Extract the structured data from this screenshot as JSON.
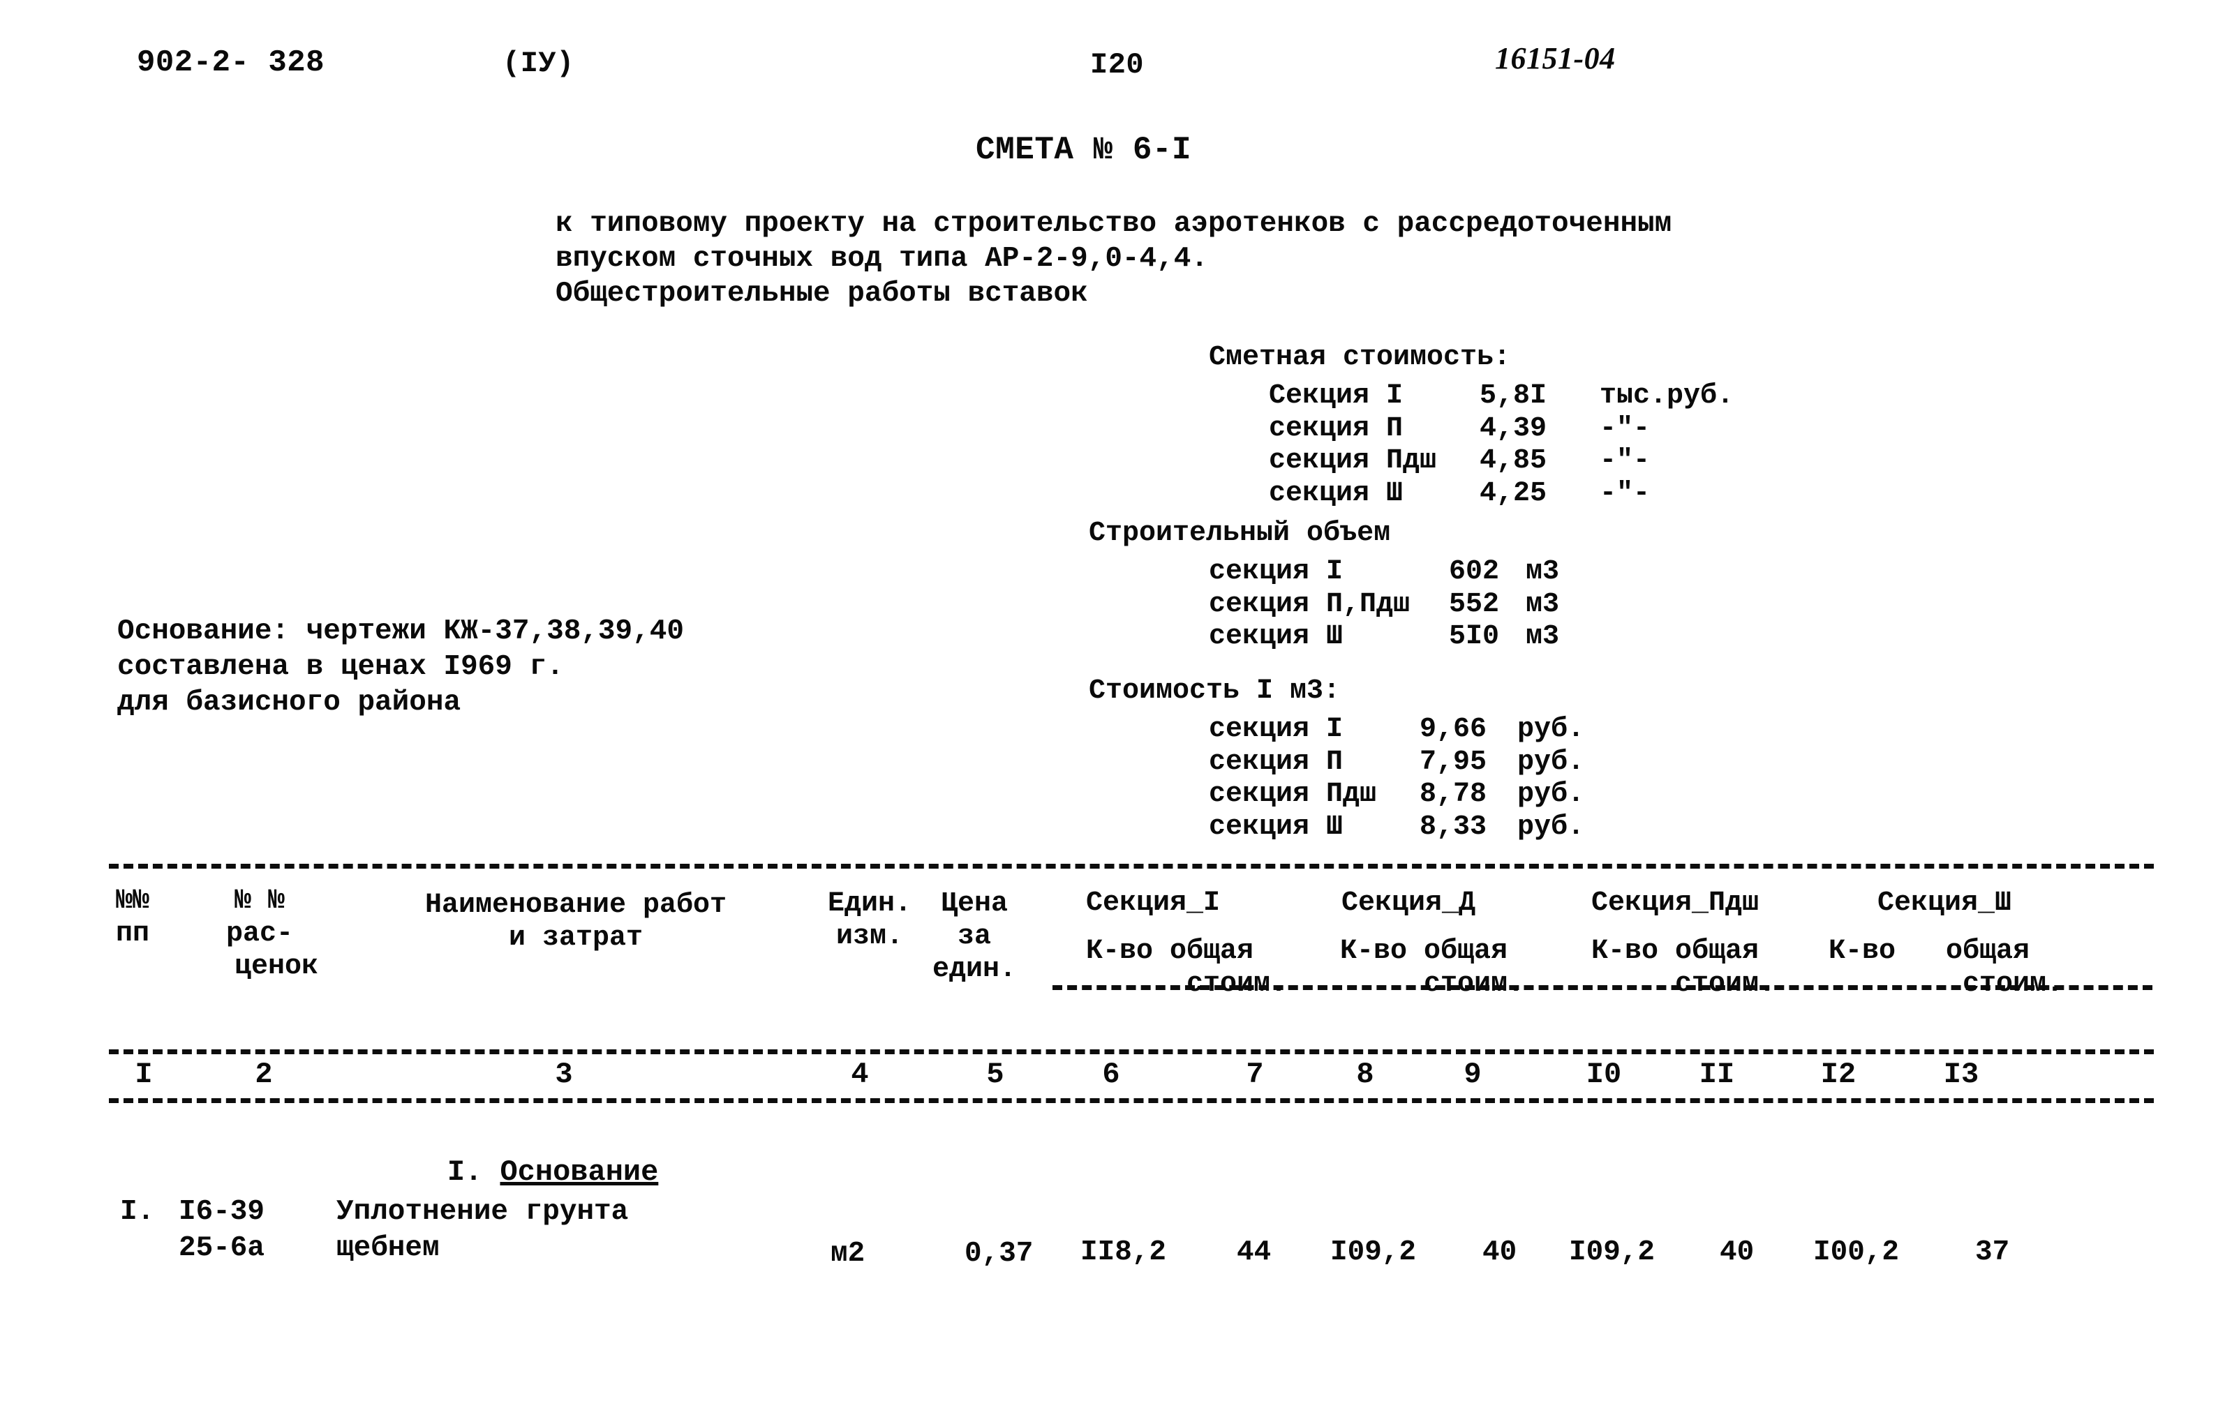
{
  "header": {
    "doc_code": "902-2- 328",
    "doc_volume": "(IУ)",
    "page_number": "I20",
    "archive_code": "16151-04"
  },
  "title": "СМЕТА № 6-I",
  "intro": "к типовому проекту на строительство аэротенков с рассредоточенным\nвпуском сточных вод типа АР-2-9,0-4,4.\nОбщестроительные работы вставок",
  "basis": "Основание: чертежи КЖ-37,38,39,40\nсоставлена в ценах I969 г.\nдля базисного района",
  "summary": {
    "cost": {
      "heading": "Сметная стоимость:",
      "rows": [
        {
          "label": "Секция I",
          "value": "5,8I",
          "unit": "тыс.руб."
        },
        {
          "label": "секция П",
          "value": "4,39",
          "unit": "-\"-"
        },
        {
          "label": "секция Пдш",
          "value": "4,85",
          "unit": "-\"-"
        },
        {
          "label": "секция Ш",
          "value": "4,25",
          "unit": "-\"-"
        }
      ]
    },
    "volume": {
      "heading": "Строительный объем",
      "rows": [
        {
          "label": "секция I",
          "value": "602",
          "unit": "м3"
        },
        {
          "label": "секция П,Пдш",
          "value": "552",
          "unit": "м3"
        },
        {
          "label": "секция Ш",
          "value": "5I0",
          "unit": "м3"
        }
      ]
    },
    "unit_cost": {
      "heading": "Стоимость I м3:",
      "rows": [
        {
          "label": "секция I",
          "value": "9,66",
          "unit": "руб."
        },
        {
          "label": "секция П",
          "value": "7,95",
          "unit": "руб."
        },
        {
          "label": "секция Пдш",
          "value": "8,78",
          "unit": "руб."
        },
        {
          "label": "секция Ш",
          "value": "8,33",
          "unit": "руб."
        }
      ]
    }
  },
  "table": {
    "headers": {
      "nn": "№№\nпп",
      "rascenok": "№ №\nрас-\n  ценок",
      "name": "Наименование работ\nи затрат",
      "unit": "Един.\nизм.",
      "price": "Цена\nза\nедин."
    },
    "section_groups": [
      {
        "title": "Секция_I",
        "sub": "К-во общая\n      стоим."
      },
      {
        "title": "Секция_Д",
        "sub": "К-во общая\n     стоим."
      },
      {
        "title": "Секция_Пдш",
        "sub": "К-во общая\n     стоим."
      },
      {
        "title": "Секция_Ш",
        "sub": "К-во   общая\n        стоим."
      }
    ],
    "column_numbers": [
      "I",
      "2",
      "3",
      "4",
      "5",
      "6",
      "7",
      "8",
      "9",
      "I0",
      "II",
      "I2",
      "I3"
    ],
    "group_heading_number": "I.",
    "group_heading_text": "Основание",
    "rows": [
      {
        "no": "I.",
        "code": "I6-39\n25-6а",
        "name": "Уплотнение грунта\nщебнем",
        "unit": "м2",
        "price": "0,37",
        "s1_qty": "II8,2",
        "s1_total": "44",
        "s2_qty": "I09,2",
        "s2_total": "40",
        "s3_qty": "I09,2",
        "s3_total": "40",
        "s4_qty": "I00,2",
        "s4_total": "37"
      }
    ]
  }
}
